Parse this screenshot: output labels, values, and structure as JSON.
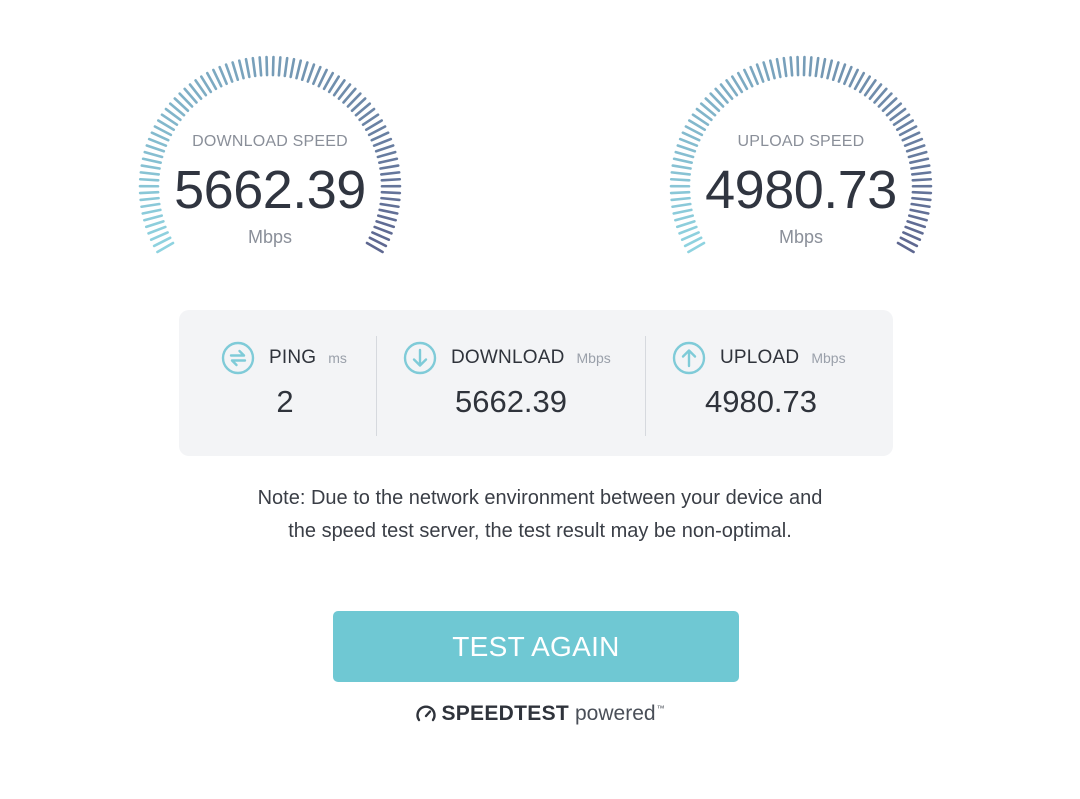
{
  "gauges": {
    "download": {
      "label": "DOWNLOAD SPEED",
      "value": "5662.39",
      "unit": "Mbps",
      "colors": [
        "#8fd3e0",
        "#5e6790"
      ]
    },
    "upload": {
      "label": "UPLOAD SPEED",
      "value": "4980.73",
      "unit": "Mbps",
      "colors": [
        "#8fd3e0",
        "#5e6790"
      ]
    }
  },
  "stats": {
    "ping": {
      "icon": "ping-icon",
      "label": "PING",
      "unit": "ms",
      "value": "2"
    },
    "download": {
      "icon": "download-arrow-icon",
      "label": "DOWNLOAD",
      "unit": "Mbps",
      "value": "5662.39"
    },
    "upload": {
      "icon": "upload-arrow-icon",
      "label": "UPLOAD",
      "unit": "Mbps",
      "value": "4980.73"
    }
  },
  "note": {
    "line1": "Note: Due to the network environment between your device and",
    "line2": "the speed test server, the test result may be non-optimal."
  },
  "button": {
    "label": "TEST AGAIN",
    "color": "#6fc8d3"
  },
  "powered_by": {
    "brand": "SPEEDTEST",
    "suffix": "powered",
    "trademark": "™"
  },
  "colors": {
    "accent": "#6fc8d3",
    "icon": "#7fcbd8",
    "text": "#2f333b",
    "muted": "#8a8f99",
    "card_bg": "#f3f4f6"
  }
}
